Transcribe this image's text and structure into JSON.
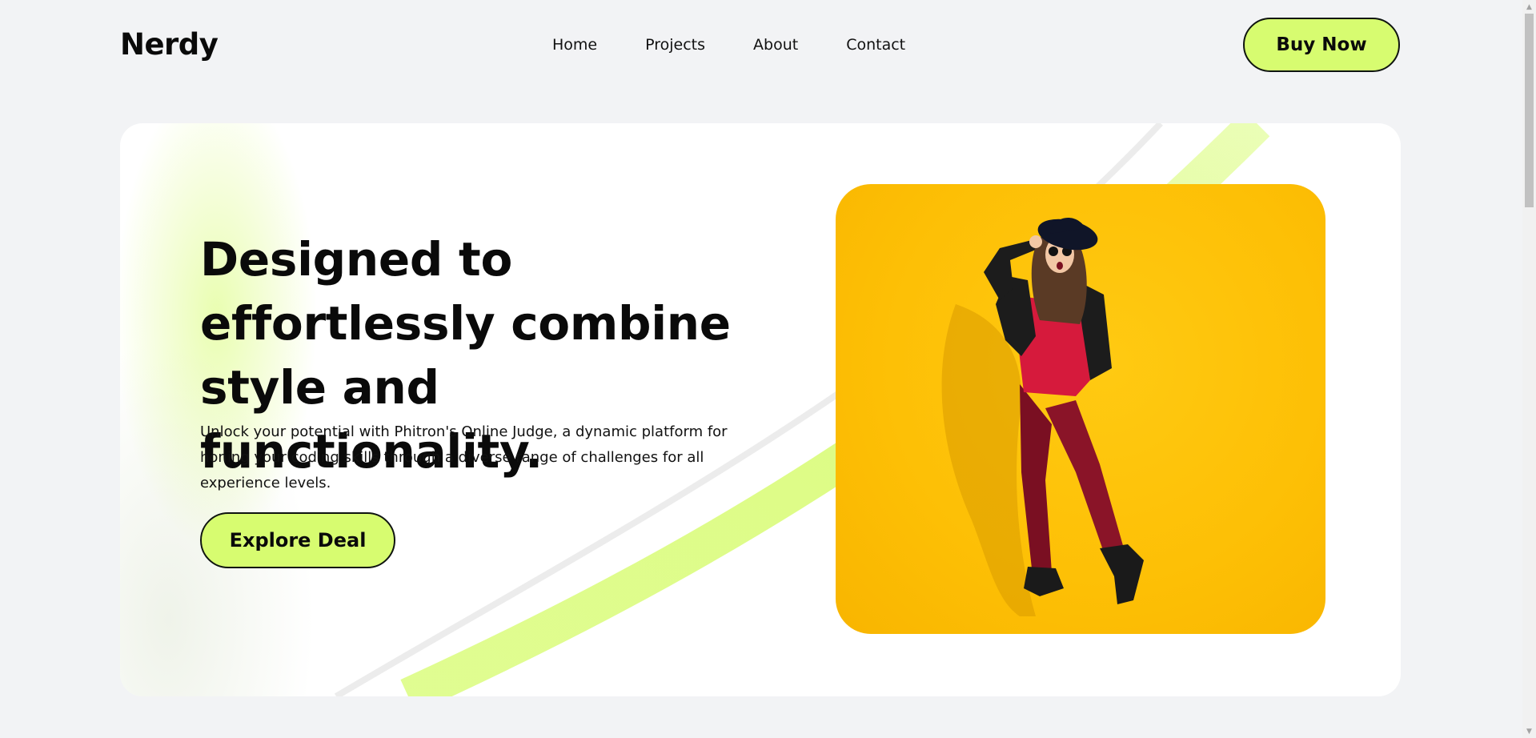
{
  "header": {
    "brand": "Nerdy",
    "nav": [
      "Home",
      "Projects",
      "About",
      "Contact"
    ],
    "cta_label": "Buy Now"
  },
  "hero": {
    "headline_lines": [
      "Designed to",
      "effortlessly combine",
      "style and functionality."
    ],
    "description": "Unlock your potential with Phitron's Online Judge, a dynamic platform for honing your coding skills through a diverse range of challenges for all experience levels.",
    "cta_label": "Explore Deal",
    "image": {
      "subject": "woman-posing-on-yellow-background"
    }
  },
  "colors": {
    "accent": "#d7fc70",
    "page_background": "#f2f3f5",
    "card_background": "#ffffff",
    "image_background": "#fdbf05"
  }
}
